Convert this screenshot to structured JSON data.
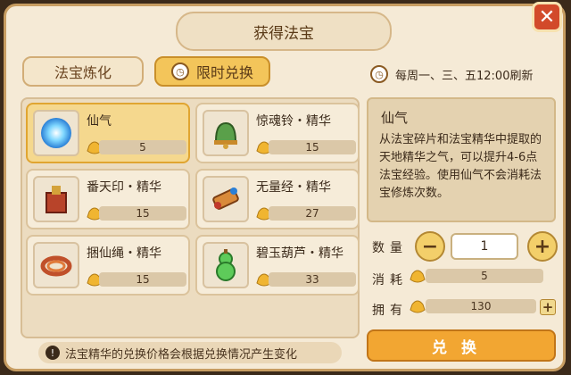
{
  "title": "获得法宝",
  "tabs": [
    {
      "label": "法宝炼化",
      "active": false
    },
    {
      "label": "限时兑换",
      "active": true
    }
  ],
  "refresh_text": "每周一、三、五12:00刷新",
  "items": [
    {
      "name": "仙气",
      "price": "5",
      "selected": true,
      "icon": "blue-orb-icon"
    },
    {
      "name": "惊魂铃・精华",
      "price": "15",
      "selected": false,
      "icon": "bell-icon"
    },
    {
      "name": "番天印・精华",
      "price": "15",
      "selected": false,
      "icon": "seal-icon"
    },
    {
      "name": "无量经・精华",
      "price": "27",
      "selected": false,
      "icon": "scroll-icon"
    },
    {
      "name": "捆仙绳・精华",
      "price": "15",
      "selected": false,
      "icon": "rope-icon"
    },
    {
      "name": "碧玉葫芦・精华",
      "price": "33",
      "selected": false,
      "icon": "gourd-icon"
    }
  ],
  "notice": "法宝精华的兑换价格会根据兑换情况产生变化",
  "detail": {
    "name": "仙气",
    "description": "从法宝碎片和法宝精华中提取的天地精华之气，可以提升4-6点法宝经验。使用仙气不会消耗法宝修炼次数。"
  },
  "quantity_label": "数量",
  "quantity": "1",
  "cost_label": "消耗",
  "cost": "5",
  "owned_label": "拥有",
  "owned": "130",
  "exchange_label": "兑换",
  "colors": {
    "accent": "#f2a632",
    "selected": "#f5d88e",
    "panel": "#f5ead6"
  }
}
